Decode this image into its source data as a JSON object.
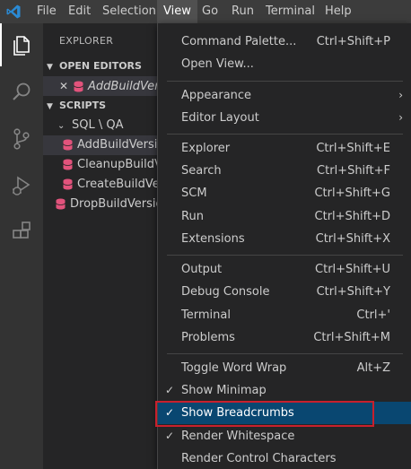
{
  "menubar": {
    "items": [
      "File",
      "Edit",
      "Selection",
      "View",
      "Go",
      "Run",
      "Terminal",
      "Help"
    ],
    "active": "View"
  },
  "activity": {
    "icons": [
      "files-icon",
      "search-icon",
      "source-control-icon",
      "run-debug-icon",
      "extensions-icon"
    ]
  },
  "sidebar": {
    "title": "EXPLORER",
    "open_editors": {
      "header": "OPEN EDITORS",
      "files": [
        "AddBuildVersion"
      ]
    },
    "scripts": {
      "header": "SCRIPTS",
      "folder": "SQL \\ QA",
      "folder_files": [
        "AddBuildVersion",
        "CleanupBuildVersion",
        "CreateBuildVersion"
      ],
      "root_files": [
        "DropBuildVersion"
      ]
    }
  },
  "view_menu": {
    "items": [
      {
        "label": "Command Palette...",
        "shortcut": "Ctrl+Shift+P"
      },
      {
        "label": "Open View...",
        "shortcut": ""
      },
      {
        "label": "Appearance",
        "shortcut": ""
      },
      {
        "label": "Editor Layout",
        "shortcut": ""
      },
      {
        "label": "Explorer",
        "shortcut": "Ctrl+Shift+E"
      },
      {
        "label": "Search",
        "shortcut": "Ctrl+Shift+F"
      },
      {
        "label": "SCM",
        "shortcut": "Ctrl+Shift+G"
      },
      {
        "label": "Run",
        "shortcut": "Ctrl+Shift+D"
      },
      {
        "label": "Extensions",
        "shortcut": "Ctrl+Shift+X"
      },
      {
        "label": "Output",
        "shortcut": "Ctrl+Shift+U"
      },
      {
        "label": "Debug Console",
        "shortcut": "Ctrl+Shift+Y"
      },
      {
        "label": "Terminal",
        "shortcut": "Ctrl+'"
      },
      {
        "label": "Problems",
        "shortcut": "Ctrl+Shift+M"
      },
      {
        "label": "Toggle Word Wrap",
        "shortcut": "Alt+Z"
      },
      {
        "label": "Show Minimap",
        "shortcut": "",
        "checked": true
      },
      {
        "label": "Show Breadcrumbs",
        "shortcut": "",
        "checked": true
      },
      {
        "label": "Render Whitespace",
        "shortcut": "",
        "checked": true
      },
      {
        "label": "Render Control Characters",
        "shortcut": ""
      }
    ],
    "submenu_marker": "›",
    "check_mark": "✓"
  },
  "colors": {
    "accent_highlight": "#094771",
    "annotation_border": "#c8202d",
    "db_icon": "#e2537c",
    "vscode_blue": "#2a8ad4"
  }
}
